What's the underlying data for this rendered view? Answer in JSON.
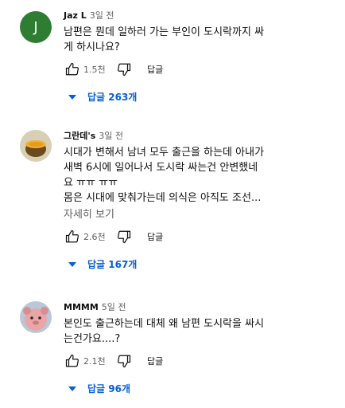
{
  "comments": [
    {
      "avatar_letter": "J",
      "author": "Jaz L",
      "time": "3일 전",
      "lines": [
        "남편은 뭔데 일하러 가는 부인이 도시락까지 싸",
        "게 하시나요?"
      ],
      "likes": "1.5천",
      "reply_label": "답글",
      "replies_label": "답글 263개"
    },
    {
      "author": "그란데's",
      "time": "3일 전",
      "lines": [
        "시대가 변해서 남녀 모두 출근을 하는데 아내가",
        "새벽 6시에 일어나서 도시락 싸는건 안변했네",
        "요 ㅠㅠ ㅠㅠ",
        "몸은 시대에 맞춰가는데 의식은 아직도 조선..."
      ],
      "more_label": "자세히 보기",
      "likes": "2.6천",
      "reply_label": "답글",
      "replies_label": "답글 167개"
    },
    {
      "author": "MMMM",
      "time": "5일 전",
      "lines": [
        "본인도 출근하는데 대체 왜 남편 도시락을 싸시",
        "는건가요....?"
      ],
      "likes": "2.1천",
      "reply_label": "답글",
      "replies_label": "답글 96개"
    }
  ],
  "icons": {
    "like": "thumbs-up-icon",
    "dislike": "thumbs-down-icon",
    "expand": "caret-down-icon"
  },
  "colors": {
    "link_blue": "#065fd4",
    "secondary_text": "#606060",
    "avatar_green": "#2e7d32"
  }
}
